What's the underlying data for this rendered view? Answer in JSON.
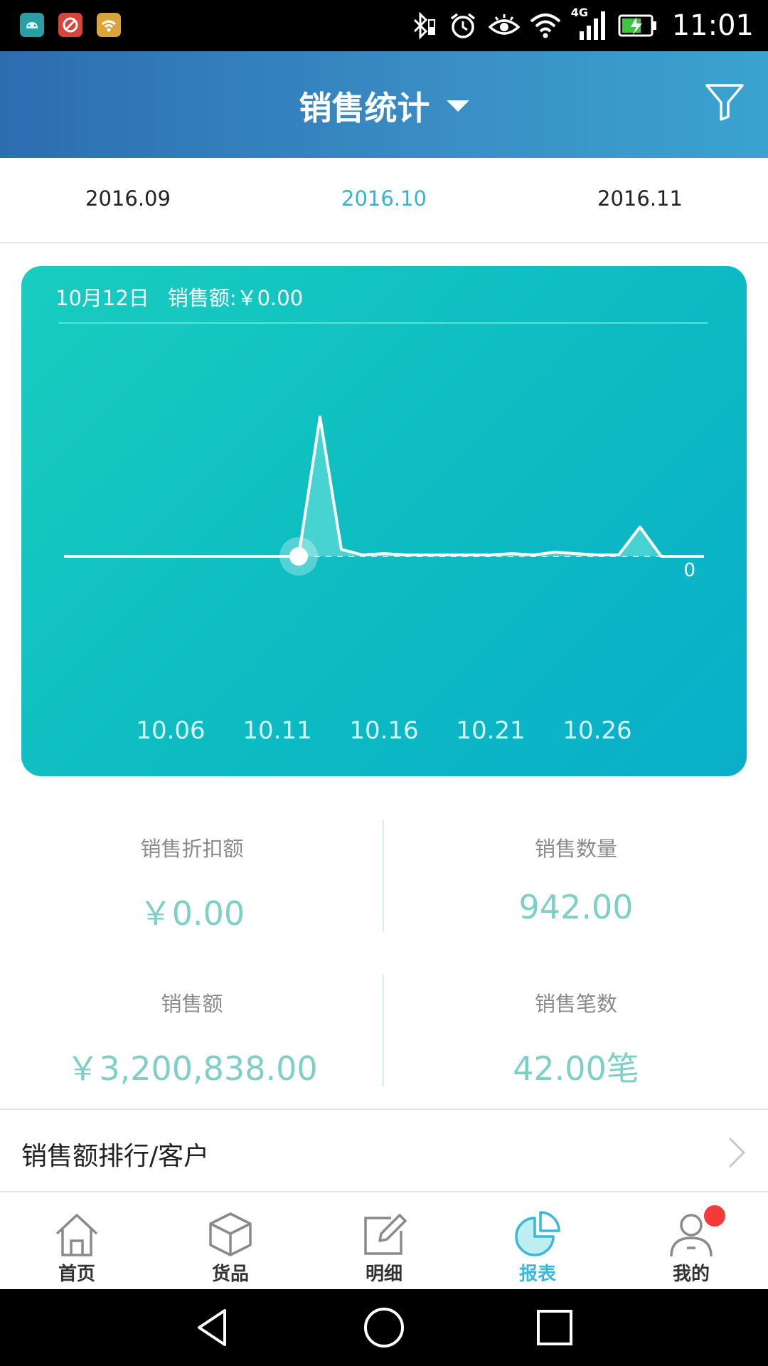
{
  "status_bar": {
    "time": "11:01",
    "network": "4G",
    "app_icons": [
      "android-debug-icon",
      "app-red-icon",
      "wifi-app-icon"
    ],
    "colors": {
      "app1": "#2a9fa3",
      "app2": "#d9443a",
      "app3": "#d9a53a"
    }
  },
  "header": {
    "title": "销售统计",
    "filter_icon": "filter-icon"
  },
  "month_tabs": [
    {
      "label": "2016.09",
      "active": false
    },
    {
      "label": "2016.10",
      "active": true
    },
    {
      "label": "2016.11",
      "active": false
    }
  ],
  "chart_info": {
    "date": "10月12日",
    "sales_text": "销售额:￥0.00"
  },
  "chart_data": {
    "type": "area",
    "x": [
      "10.01",
      "10.02",
      "10.03",
      "10.04",
      "10.05",
      "10.06",
      "10.07",
      "10.08",
      "10.09",
      "10.10",
      "10.11",
      "10.12",
      "10.13",
      "10.14",
      "10.15",
      "10.16",
      "10.17",
      "10.18",
      "10.19",
      "10.20",
      "10.21",
      "10.22",
      "10.23",
      "10.24",
      "10.25",
      "10.26",
      "10.27",
      "10.28",
      "10.29",
      "10.30",
      "10.31"
    ],
    "tick_labels": [
      "10.06",
      "10.11",
      "10.16",
      "10.21",
      "10.26"
    ],
    "series": [
      {
        "values": [
          0,
          0,
          0,
          0,
          0,
          0,
          0,
          0,
          0,
          0,
          0,
          0,
          1,
          0.05,
          0.01,
          0.02,
          0.01,
          0.01,
          0.01,
          0.01,
          0.01,
          0.02,
          0.01,
          0.03,
          0.02,
          0.01,
          0.01,
          0.21,
          0,
          0,
          0
        ]
      }
    ],
    "ylim": [
      0,
      1
    ],
    "baseline_label": "0",
    "selected_index": 11,
    "colors": {
      "line": "#ffffff",
      "fill": "#5ad9d6",
      "grid": "#7fe3e0"
    }
  },
  "stats": [
    {
      "label": "销售折扣额",
      "value": "￥0.00"
    },
    {
      "label": "销售数量",
      "value": "942.00"
    },
    {
      "label": "销售额",
      "value": "￥3,200,838.00"
    },
    {
      "label": "销售笔数",
      "value": "42.00笔"
    }
  ],
  "ranking": {
    "label": "销售额排行/客户"
  },
  "bottom_nav": [
    {
      "label": "首页",
      "icon": "home-icon",
      "active": false
    },
    {
      "label": "货品",
      "icon": "box-icon",
      "active": false
    },
    {
      "label": "明细",
      "icon": "edit-icon",
      "active": false
    },
    {
      "label": "报表",
      "icon": "pie-chart-icon",
      "active": true
    },
    {
      "label": "我的",
      "icon": "user-icon",
      "active": false,
      "badge": true
    }
  ],
  "theme": {
    "accent": "#39b8d8",
    "stat_value_color": "#7dd0c6",
    "badge_color": "#f53a3a"
  }
}
